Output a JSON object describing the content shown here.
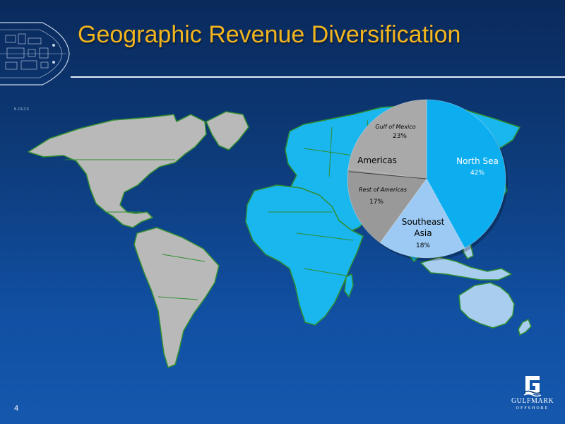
{
  "slide": {
    "title": "Geographic Revenue Diversification",
    "page_number": "4",
    "deck_label": "B-DECK"
  },
  "logo": {
    "name": "GULFMARK",
    "subtitle": "OFFSHORE"
  },
  "colors": {
    "title": "#f2b51e",
    "land_gray": "#b9b9b9",
    "land_cyan": "#1ab6ee",
    "land_light_blue": "#a8cdef",
    "border_green": "#2f8f2f"
  },
  "chart_data": {
    "type": "pie",
    "title": "",
    "slices": [
      {
        "label": "North Sea",
        "value": 42,
        "value_label": "42%",
        "color": "#0daef0"
      },
      {
        "label": "Southeast Asia",
        "value": 18,
        "value_label": "18%",
        "color": "#9ccaf4"
      },
      {
        "label": "Rest of Americas",
        "value": 17,
        "value_label": "17%",
        "color": "#999999"
      },
      {
        "label": "Gulf of Mexico",
        "value": 23,
        "value_label": "23%",
        "color": "#a9a9a9"
      }
    ],
    "group_label": "Americas"
  }
}
